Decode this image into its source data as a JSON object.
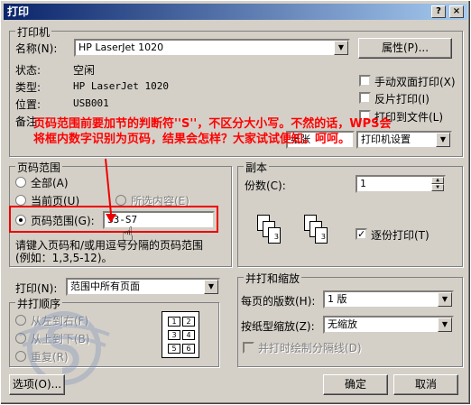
{
  "title": "打印",
  "title_buttons": [
    "?",
    "×"
  ],
  "printer": {
    "group": "打印机",
    "name_label": "名称(N):",
    "name_value": "HP LaserJet 1020",
    "props_btn": "属性(P)...",
    "status_label": "状态:",
    "status_value": "空闲",
    "type_label": "类型:",
    "type_value": "HP LaserJet 1020",
    "where_label": "位置:",
    "where_value": "USB001",
    "comment_label": "备注:",
    "duplex": "手动双面打印(X)",
    "reverse": "反片打印(I)",
    "to_file": "打印到文件(L)",
    "paper_combo": "纸张",
    "printer_settings": "打印机设置"
  },
  "annotation": "页码范围前要加节的判断符''S''，不区分大小写。不然的话，WPS会将框内数字识别为页码，结果会怎样？大家试试便知。呵呵。",
  "range": {
    "group": "页码范围",
    "all": "全部(A)",
    "current": "当前页(U)",
    "selection": "所选内容(E)",
    "pages": "页码范围(G):",
    "pages_value": "S3-S7",
    "hint": "请键入页码和/或用逗号分隔的页码范围(例如：1,3,5-12)。"
  },
  "copies": {
    "group": "副本",
    "count_label": "份数(C):",
    "count_value": "1",
    "collate": "逐份打印(T)",
    "pages_a": [
      "1",
      "2",
      "3"
    ],
    "pages_b": [
      "1",
      "2",
      "3"
    ]
  },
  "print_what": {
    "label": "打印(N):",
    "value": "范围中所有页面"
  },
  "order": {
    "group": "并打顺序",
    "ltr": "从左到右(F)",
    "ttb": "从上到下(B)",
    "repeat": "重复(R)",
    "grid": [
      "1",
      "2",
      "3",
      "4",
      "5",
      "6"
    ]
  },
  "zoom": {
    "group": "并打和缩放",
    "pps_label": "每页的版数(H):",
    "pps_value": "1 版",
    "scale_label": "按纸型缩放(Z):",
    "scale_value": "无缩放",
    "draw_border": "并打时绘制分隔线(D)"
  },
  "buttons": {
    "options": "选项(O)...",
    "ok": "确定",
    "cancel": "取消"
  }
}
